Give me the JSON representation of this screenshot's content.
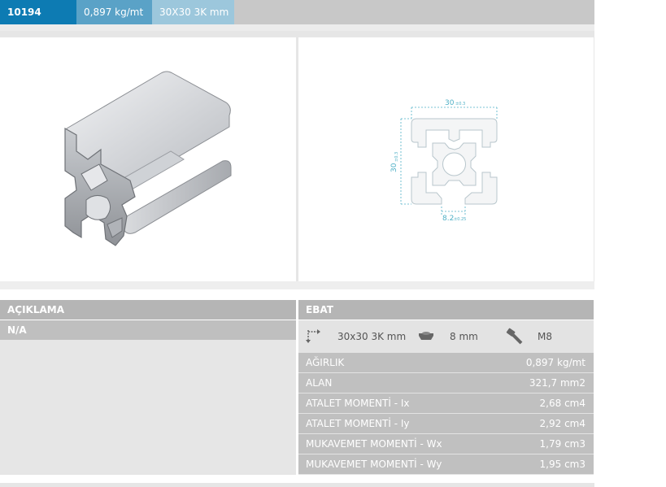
{
  "header": {
    "code": "10194",
    "weight": "0,897 kg/mt",
    "size": "30X30 3K mm"
  },
  "drawing": {
    "width_label": "30",
    "width_tol": "±0.3",
    "height_label": "30",
    "height_tol": "±0.3",
    "slot_label": "8.2",
    "slot_tol": "±0.25"
  },
  "description": {
    "title": "AÇIKLAMA",
    "value": "N/A"
  },
  "dimensions": {
    "title": "EBAT",
    "profile_size": "30x30 3K mm",
    "slot": "8 mm",
    "bolt": "M8",
    "icons": [
      "corner-arrows-icon",
      "t-nut-icon",
      "bolt-icon"
    ]
  },
  "specs": [
    {
      "key": "AĞIRLIK",
      "value": "0,897 kg/mt"
    },
    {
      "key": "ALAN",
      "value": "321,7 mm2"
    },
    {
      "key": "ATALET MOMENTİ - Ix",
      "value": "2,68 cm4"
    },
    {
      "key": "ATALET MOMENTİ - Iy",
      "value": "2,92 cm4"
    },
    {
      "key": "MUKAVEMET MOMENTİ - Wx",
      "value": "1,79 cm3"
    },
    {
      "key": "MUKAVEMET MOMENTİ - Wy",
      "value": "1,95 cm3"
    }
  ],
  "colors": {
    "code_bg": "#0d7bb3",
    "weight_bg": "#5aa2c7",
    "size_bg": "#9cc7dc",
    "dimension_line": "#4fb0c6"
  }
}
